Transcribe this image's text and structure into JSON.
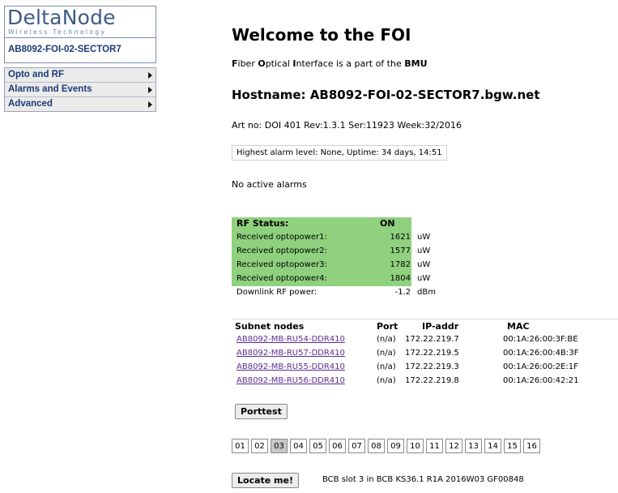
{
  "sidebar": {
    "logo": {
      "main": "DeltaNode",
      "sub": "Wireless Technology"
    },
    "host_label": "AB8092-FOI-02-SECTOR7",
    "menu": [
      {
        "label": "Opto and RF"
      },
      {
        "label": "Alarms and Events"
      },
      {
        "label": "Advanced"
      }
    ]
  },
  "main": {
    "title": "Welcome to the FOI",
    "intro": {
      "f": "F",
      "iber": "iber ",
      "o": "O",
      "ptical": "ptical ",
      "i": "I",
      "rest": "nterface is a part of the ",
      "bmu": "BMU"
    },
    "hostname": "Hostname: AB8092-FOI-02-SECTOR7.bgw.net",
    "artno": "Art no: DOI 401 Rev:1.3.1 Ser:11923 Week:32/2016",
    "alarm_box": "Highest alarm level:  None,   Uptime: 34 days, 14:51",
    "no_alarms": "No active alarms",
    "rf_status": {
      "label": "RF Status:",
      "value": "ON",
      "rows": [
        {
          "label": "Received optopower1:",
          "value": "1621",
          "unit": "uW"
        },
        {
          "label": "Received optopower2:",
          "value": "1577",
          "unit": "uW"
        },
        {
          "label": "Received optopower3:",
          "value": "1782",
          "unit": "uW"
        },
        {
          "label": "Received optopower4:",
          "value": "1804",
          "unit": "uW"
        }
      ],
      "downlink": {
        "label": "Downlink RF power:",
        "value": "-1.2",
        "unit": "dBm"
      },
      "highlight_color": "#8fd17e"
    },
    "subnet": {
      "headers": {
        "name": "Subnet nodes",
        "port": "Port",
        "ip": "IP-addr",
        "mac": "MAC"
      },
      "rows": [
        {
          "name": "AB8092-MB-RU54-DDR410",
          "port": "(n/a)",
          "ip": "172.22.219.7",
          "mac": "00:1A:26:00:3F:BE"
        },
        {
          "name": "AB8092-MB-RU57-DDR410",
          "port": "(n/a)",
          "ip": "172.22.219.5",
          "mac": "00:1A:26:00:4B:3F"
        },
        {
          "name": "AB8092-MB-RU55-DDR410",
          "port": "(n/a)",
          "ip": "172.22.219.3",
          "mac": "00:1A:26:00:2E:1F"
        },
        {
          "name": "AB8092-MB-RU56-DDR410",
          "port": "(n/a)",
          "ip": "172.22.219.8",
          "mac": "00:1A:26:00:42:21"
        }
      ],
      "porttest_label": "Porttest"
    },
    "slots": [
      "01",
      "02",
      "03",
      "04",
      "05",
      "06",
      "07",
      "08",
      "09",
      "10",
      "11",
      "12",
      "13",
      "14",
      "15",
      "16"
    ],
    "active_slot": "03",
    "locate_label": "Locate me!",
    "locate_info": "BCB slot 3 in BCB KS36.1 R1A 2016W03 GF00848"
  }
}
